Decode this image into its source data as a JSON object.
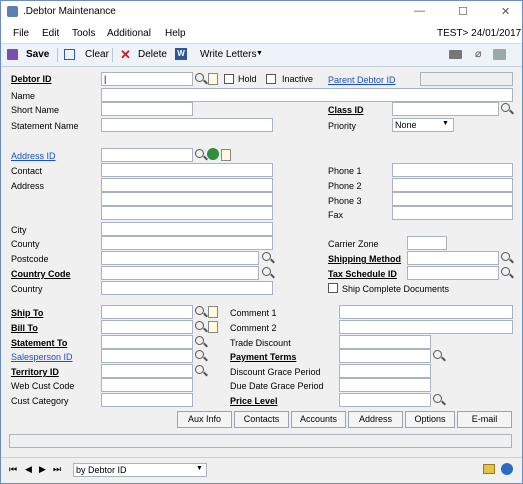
{
  "window": {
    "title": ".Debtor Maintenance",
    "minimize": "—",
    "maximize": "☐",
    "close": "✕"
  },
  "menu": {
    "items": [
      "File",
      "Edit",
      "Tools",
      "Additional",
      "Help"
    ],
    "status": "TEST>  24/01/2017"
  },
  "toolbar": {
    "save": "Save",
    "clear": "Clear",
    "delete": "Delete",
    "write_letters": "Write Letters"
  },
  "labels": {
    "debtor_id": "Debtor ID",
    "hold": "Hold",
    "inactive": "Inactive",
    "parent_debtor_id": "Parent Debtor ID",
    "name": "Name",
    "short_name": "Short Name",
    "statement_name": "Statement Name",
    "class_id": "Class ID",
    "priority": "Priority",
    "address_id": "Address ID",
    "contact": "Contact",
    "address": "Address",
    "city": "City",
    "county": "County",
    "postcode": "Postcode",
    "country_code": "Country Code",
    "country": "Country",
    "phone1": "Phone 1",
    "phone2": "Phone 2",
    "phone3": "Phone 3",
    "fax": "Fax",
    "carrier_zone": "Carrier Zone",
    "shipping_method": "Shipping Method",
    "tax_schedule_id": "Tax Schedule ID",
    "ship_complete": "Ship Complete Documents",
    "ship_to": "Ship To",
    "bill_to": "Bill To",
    "statement_to": "Statement To",
    "salesperson_id": "Salesperson ID",
    "territory_id": "Territory ID",
    "web_cust_code": "Web Cust Code",
    "cust_category": "Cust Category",
    "comment1": "Comment 1",
    "comment2": "Comment 2",
    "trade_discount": "Trade Discount",
    "payment_terms": "Payment Terms",
    "discount_grace": "Discount Grace Period",
    "due_date_grace": "Due Date Grace Period",
    "price_level": "Price Level"
  },
  "values": {
    "debtor_id": "|",
    "priority": "None"
  },
  "buttons": {
    "aux_info": "Aux Info",
    "contacts": "Contacts",
    "accounts": "Accounts",
    "address": "Address",
    "options": "Options",
    "email": "E-mail"
  },
  "navigation": {
    "sort_by": "by Debtor ID",
    "first": "⏮",
    "prev": "◀",
    "next": "▶",
    "last": "⏭"
  }
}
